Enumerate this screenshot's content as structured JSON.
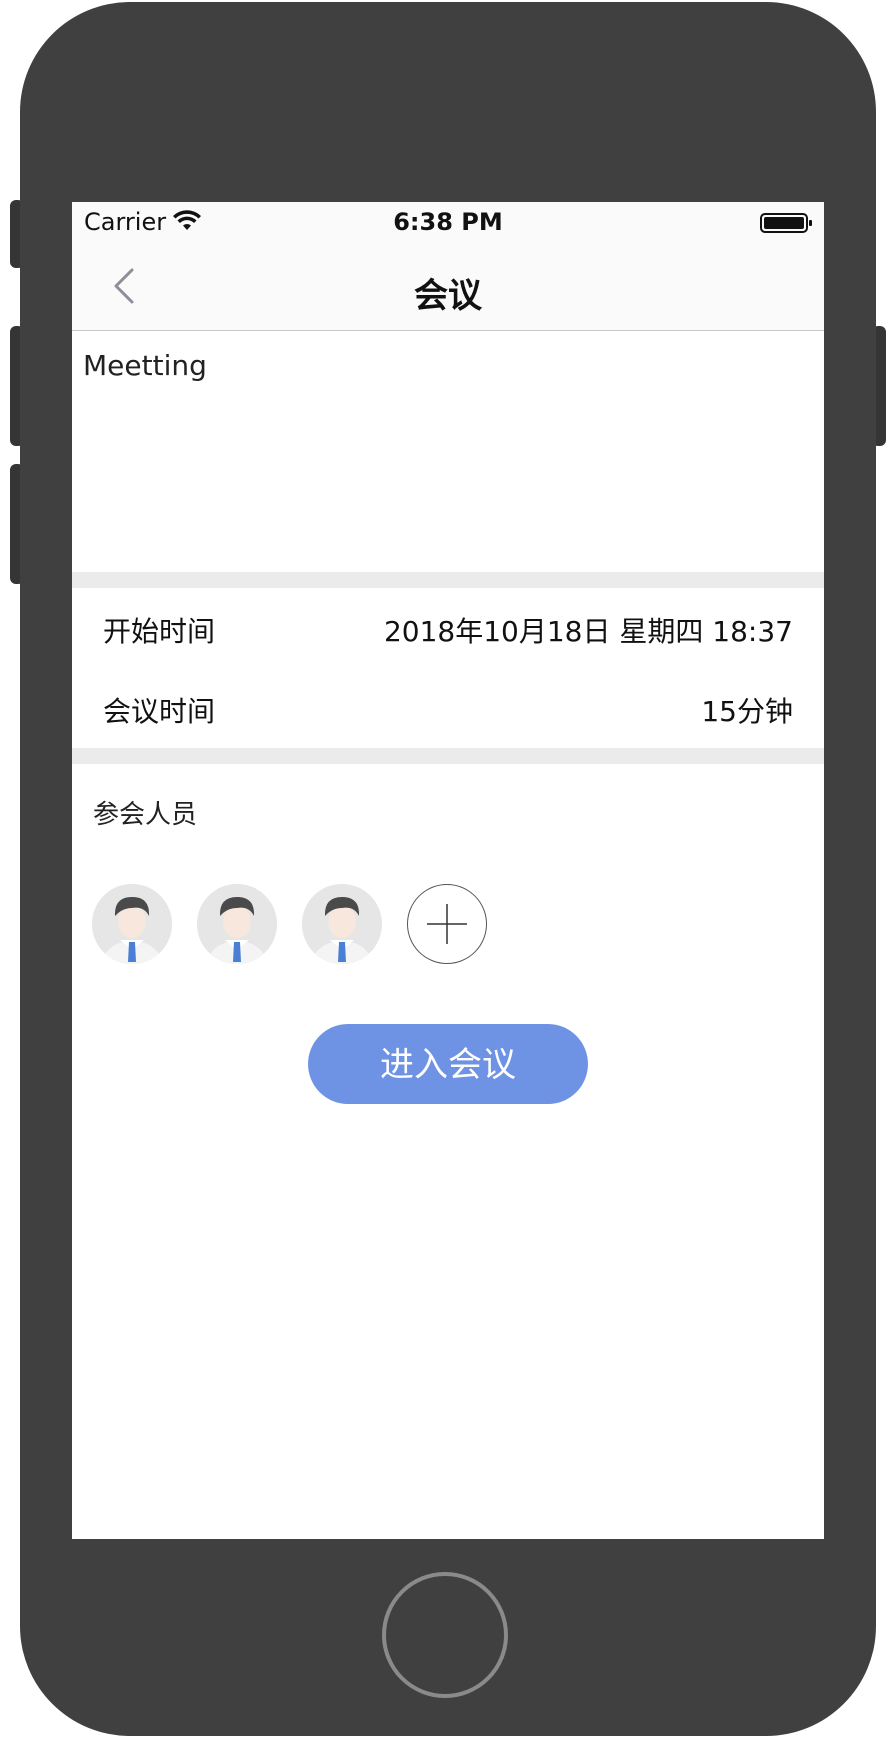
{
  "status_bar": {
    "carrier": "Carrier",
    "time": "6:38 PM"
  },
  "nav": {
    "title": "会议",
    "back_icon": "chevron-left-icon"
  },
  "meeting": {
    "subject": "Meetting"
  },
  "details": {
    "start_time_label": "开始时间",
    "start_time_value": "2018年10月18日 星期四 18:37",
    "duration_label": "会议时间",
    "duration_value": "15分钟"
  },
  "participants": {
    "title": "参会人员",
    "avatars": [
      "avatar",
      "avatar",
      "avatar"
    ],
    "add_icon": "plus-icon"
  },
  "actions": {
    "enter_label": "进入会议"
  },
  "colors": {
    "accent": "#6f93e4",
    "separator": "#ebebeb",
    "phone_body": "#404040"
  }
}
